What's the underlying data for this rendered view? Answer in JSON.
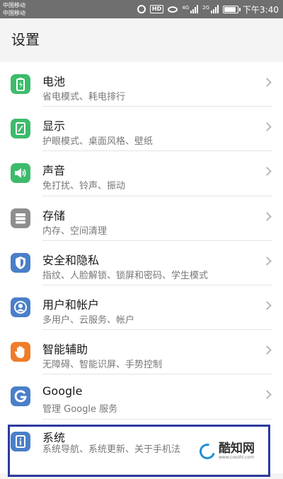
{
  "status_bar": {
    "carrier_1": "中国移动",
    "carrier_2": "中国移动",
    "hd_badge": "HD",
    "sig1_label": "4G",
    "sig2_label": "2G",
    "time": "下午3:40",
    "battery_level": 0.8
  },
  "page": {
    "title": "设置"
  },
  "items": [
    {
      "label": "电池",
      "description": "省电模式、耗电排行",
      "icon": "battery-icon",
      "color": "#3dbb6c"
    },
    {
      "label": "显示",
      "description": "护眼模式、桌面风格、壁纸",
      "icon": "display-icon",
      "color": "#3dbb6c"
    },
    {
      "label": "声音",
      "description": "免打扰、铃声、振动",
      "icon": "speaker-icon",
      "color": "#3dbb6c"
    },
    {
      "label": "存储",
      "description": "内存、空间清理",
      "icon": "storage-icon",
      "color": "#8e8e8e"
    },
    {
      "label": "安全和隐私",
      "description": "指纹、人脸解锁、锁屏和密码、学生模式",
      "icon": "shield-icon",
      "color": "#4a7fc9"
    },
    {
      "label": "用户和帐户",
      "description": "多用户、云服务、帐户",
      "icon": "user-icon",
      "color": "#4a7fc9"
    },
    {
      "label": "智能辅助",
      "description": "无障碍、智能识屏、手势控制",
      "icon": "hand-icon",
      "color": "#ef7d2a"
    },
    {
      "label": "Google",
      "description": "管理 Google 服务",
      "icon": "google-icon",
      "color": "#4a7fc9"
    },
    {
      "label": "系统",
      "description": "系统导航、系统更新、关于手机法",
      "icon": "info-icon",
      "color": "#4a7fc9"
    }
  ],
  "watermark": {
    "name": "酷知网",
    "url": "www.coozhi.com"
  }
}
